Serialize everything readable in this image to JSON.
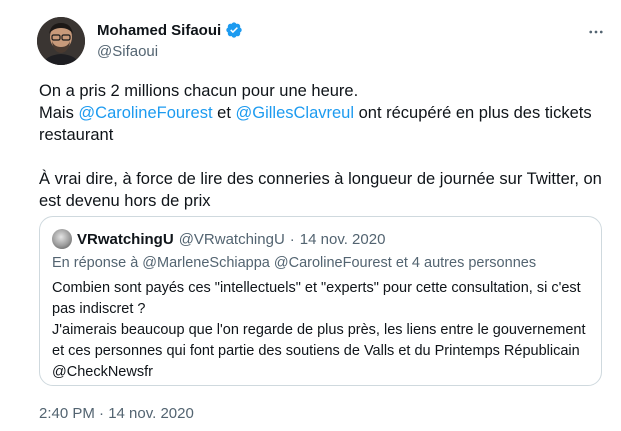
{
  "author": {
    "display_name": "Mohamed Sifaoui",
    "handle": "@Sifaoui",
    "verified_icon": "verified-badge-icon",
    "avatar_icon": "profile-photo"
  },
  "more_icon": "more-horizontal-icon",
  "tweet": {
    "line1": "On a pris 2 millions chacun pour une heure.",
    "line2_prefix": "Mais ",
    "mention1": "@CarolineFourest",
    "line2_mid": " et ",
    "mention2": "@GillesClavreul",
    "line2_suffix": " ont récupéré en plus des tickets restaurant",
    "para2": "À vrai dire, à force de lire des conneries à longueur de journée sur Twitter, on est devenu hors de prix"
  },
  "quote": {
    "name": "VRwatchingU",
    "handle": "@VRwatchingU",
    "separator": "·",
    "date": "14 nov. 2020",
    "reply_prefix": "En réponse à",
    "reply_to": "@MarleneSchiappa @CarolineFourest",
    "reply_suffix": "et 4 autres personnes",
    "text_line1": "Combien sont payés ces \"intellectuels\" et \"experts\" pour cette consultation, si c'est pas indiscret ?",
    "text_line2": "J'aimerais beaucoup que l'on regarde de plus près, les liens entre le gouvernement et ces personnes qui font partie des soutiens de Valls et du Printemps Républicain @CheckNewsfr"
  },
  "timestamp": "2:40 PM · 14 nov. 2020",
  "colors": {
    "accent": "#1d9bf0",
    "text_primary": "#0f1419",
    "text_secondary": "#536471",
    "border": "#cfd9de"
  }
}
